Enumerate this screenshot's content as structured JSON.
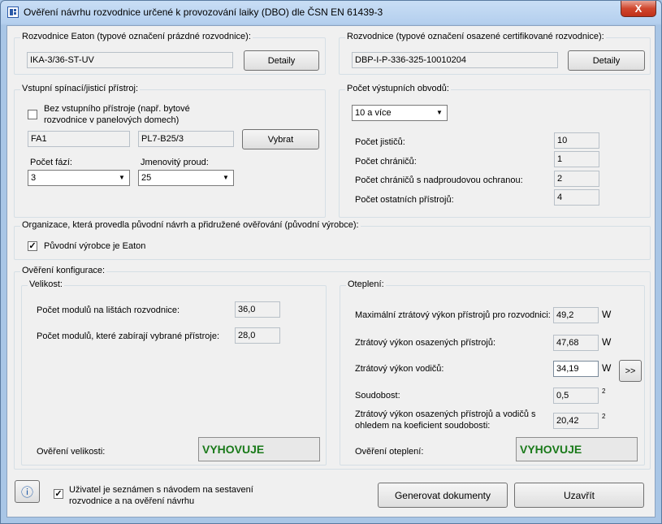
{
  "window": {
    "title": "Ověření návrhu rozvodnice určené k provozování laiky (DBO)  dle ČSN EN 61439-3",
    "close_label": "X"
  },
  "empty_board": {
    "group_label": "Rozvodnice Eaton (typové označení prázdné rozvodnice):",
    "value": "IKA-3/36-ST-UV",
    "details_label": "Detaily"
  },
  "cert_board": {
    "group_label": "Rozvodnice (typové označení osazené certifikované rozvodnice):",
    "value": "DBP-I-P-336-325-10010204",
    "details_label": "Detaily"
  },
  "input_device": {
    "group_label": "Vstupní spínací/jisticí přístroj:",
    "no_device_label_1": "Bez vstupního přístroje (např. bytové",
    "no_device_label_2": "rozvodnice v panelových domech)",
    "no_device_checked": false,
    "designation": "FA1",
    "device_type": "PL7-B25/3",
    "select_label": "Vybrat",
    "phases_label": "Počet fází:",
    "phases_value": "3",
    "current_label": "Jmenovitý proud:",
    "current_value": "25"
  },
  "output_circuits": {
    "group_label": "Počet výstupních obvodů:",
    "combo_value": "10 a více",
    "rows": [
      {
        "label": "Počet jističů:",
        "value": "10"
      },
      {
        "label": "Počet chráničů:",
        "value": "1"
      },
      {
        "label": "Počet chráničů s nadproudovou ochranou:",
        "value": "2"
      },
      {
        "label": "Počet ostatních přístrojů:",
        "value": "4"
      }
    ]
  },
  "organization": {
    "group_label": "Organizace, která provedla původní návrh a přidružené ověřování (původní výrobce):",
    "eaton_label": "Původní výrobce je Eaton",
    "eaton_checked": true
  },
  "verification": {
    "group_label": "Ověření konfigurace:",
    "size": {
      "group_label": "Velikost:",
      "modules_total_label": "Počet modulů na lištách rozvodnice:",
      "modules_total_value": "36,0",
      "modules_used_label": "Počet modulů, které zabírají vybrané přístroje:",
      "modules_used_value": "28,0",
      "result_label": "Ověření velikosti:",
      "result_value": "VYHOVUJE"
    },
    "heat": {
      "group_label": "Oteplení:",
      "max_loss_label": "Maximální ztrátový výkon přístrojů pro rozvodnici:",
      "max_loss_value": "49,2",
      "device_loss_label": "Ztrátový výkon osazených přístrojů:",
      "device_loss_value": "47,68",
      "wire_loss_label": "Ztrátový výkon vodičů:",
      "wire_loss_value": "34,19",
      "more_label": ">>",
      "simultaneity_label": "Soudobost:",
      "simultaneity_value": "0,5",
      "total_label_1": "Ztrátový výkon osazených přístrojů a vodičů s",
      "total_label_2": "ohledem na koeficient soudobosti:",
      "total_value": "20,42",
      "unit_w": "W",
      "sup2": "2",
      "result_label": "Ověření oteplení:",
      "result_value": "VYHOVUJE"
    }
  },
  "footer": {
    "info_label": "ⓘ",
    "ack_label_1": "Uživatel je seznámen s návodem na sestavení",
    "ack_label_2": "rozvodnice a na ověření návrhu",
    "ack_checked": true,
    "generate_label": "Generovat dokumenty",
    "close_label": "Uzavřít"
  }
}
